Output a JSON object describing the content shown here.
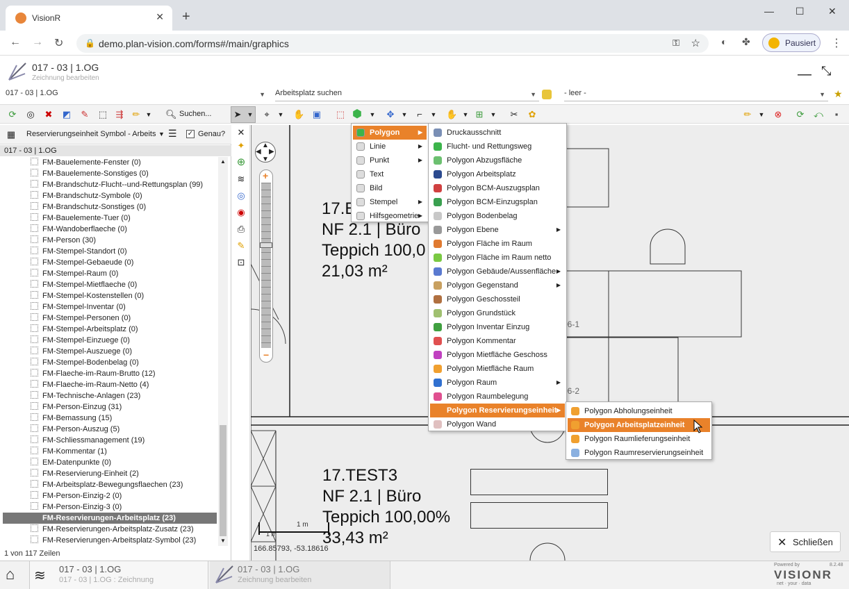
{
  "browser": {
    "tab_title": "VisionR",
    "new_tab": "+",
    "url": "demo.plan-vision.com/forms#/main/graphics",
    "paused_label": "Pausiert"
  },
  "header": {
    "title": "017 - 03 | 1.OG",
    "subtitle": "Zeichnung bearbeiten"
  },
  "selectors": {
    "drawing": "017 - 03 | 1.OG",
    "workplace_search": "Arbeitsplatz suchen",
    "empty": "- leer -"
  },
  "toolbar": {
    "search_label": "Suchen..."
  },
  "left_panel": {
    "layer_select": "Reservierungseinheit Symbol - Arbeits",
    "exact_label": "Genau?",
    "exact_checked": true,
    "group_header": "017 - 03 | 1.OG",
    "items": [
      "FM-Bauelemente-Fenster (0)",
      "FM-Bauelemente-Sonstiges (0)",
      "FM-Brandschutz-Flucht--und-Rettungsplan (99)",
      "FM-Brandschutz-Symbole (0)",
      "FM-Brandschutz-Sonstiges (0)",
      "FM-Bauelemente-Tuer (0)",
      "FM-Wandoberflaeche (0)",
      "FM-Person (30)",
      "FM-Stempel-Standort (0)",
      "FM-Stempel-Gebaeude (0)",
      "FM-Stempel-Raum (0)",
      "FM-Stempel-Mietflaeche (0)",
      "FM-Stempel-Kostenstellen (0)",
      "FM-Stempel-Inventar (0)",
      "FM-Stempel-Personen (0)",
      "FM-Stempel-Arbeitsplatz (0)",
      "FM-Stempel-Einzuege (0)",
      "FM-Stempel-Auszuege (0)",
      "FM-Stempel-Bodenbelag (0)",
      "FM-Flaeche-im-Raum-Brutto (12)",
      "FM-Flaeche-im-Raum-Netto (4)",
      "FM-Technische-Anlagen (23)",
      "FM-Person-Einzug (31)",
      "FM-Bemassung (15)",
      "FM-Person-Auszug (5)",
      "FM-Schliessmanagement (19)",
      "FM-Kommentar (1)",
      "EM-Datenpunkte (0)",
      "FM-Reservierung-Einheit (2)",
      "FM-Arbeitsplatz-Bewegungsflaechen (23)",
      "FM-Person-Einzig-2 (0)",
      "FM-Person-Einzig-3 (0)",
      "FM-Reservierungen-Arbeitsplatz (23)",
      "FM-Reservierungen-Arbeitsplatz-Zusatz (23)",
      "FM-Reservierungen-Arbeitsplatz-Symbol (23)"
    ],
    "selected_index": 32,
    "row_count": "1 von 117 Zeilen"
  },
  "canvas": {
    "room1_lines": [
      "17.E",
      "NF 2.1 | Büro",
      "Teppich 100,0",
      "21,03 m²"
    ],
    "room2_lines": [
      "17.TEST3",
      "NF 2.1 | Büro",
      "Teppich 100,00%",
      "33,43 m²"
    ],
    "label_a": "06-1",
    "label_b": "06-2",
    "scale_a": "1 m",
    "scale_b": "1 m",
    "coordinates": "166.85793, -53.18616",
    "zoom_plus": "+",
    "zoom_minus": "−"
  },
  "menu1": {
    "items": [
      "Polygon",
      "Linie",
      "Punkt",
      "Text",
      "Bild",
      "Stempel",
      "Hilfsgeometrie"
    ],
    "submenu": [
      true,
      true,
      true,
      false,
      false,
      true,
      true
    ],
    "icons": [
      "polygon-icon",
      "hexagon-outline-icon",
      "dot-icon",
      "text-icon",
      "image-icon",
      "stamp-icon",
      "helper-geometry-icon"
    ],
    "active_index": 0
  },
  "menu2": {
    "items": [
      "Druckausschnitt",
      "Flucht- und Rettungsweg",
      "Polygon Abzugsfläche",
      "Polygon Arbeitsplatz",
      "Polygon BCM-Auszugsplan",
      "Polygon BCM-Einzugsplan",
      "Polygon Bodenbelag",
      "Polygon Ebene",
      "Polygon Fläche im Raum",
      "Polygon Fläche im Raum netto",
      "Polygon Gebäude/Aussenfläche",
      "Polygon Gegenstand",
      "Polygon Geschossteil",
      "Polygon Grundstück",
      "Polygon Inventar Einzug",
      "Polygon Kommentar",
      "Polygon Mietfläche Geschoss",
      "Polygon Mietfläche Raum",
      "Polygon Raum",
      "Polygon Raumbelegung",
      "Polygon Reservierungseinheit",
      "Polygon Wand"
    ],
    "submenu": [
      false,
      false,
      false,
      false,
      false,
      false,
      false,
      true,
      false,
      false,
      true,
      true,
      false,
      false,
      false,
      false,
      false,
      false,
      true,
      false,
      true,
      false
    ],
    "colors": [
      "#7a8fb5",
      "#3cb44b",
      "#6cc070",
      "#2b4a8f",
      "#d04040",
      "#3aa050",
      "#c8c8c8",
      "#999999",
      "#e07a30",
      "#7ac943",
      "#5a7ad0",
      "#c8a060",
      "#b07040",
      "#a0c070",
      "#40a040",
      "#e05050",
      "#c040c0",
      "#f0a030",
      "#3070d0",
      "#e05090",
      "#e9822a",
      "#e0c0c0"
    ],
    "active_index": 20
  },
  "menu3": {
    "items": [
      "Polygon Abholungseinheit",
      "Polygon Arbeitsplatzeinheit",
      "Polygon Raumlieferungseinheit",
      "Polygon Raumreservierungseinheit"
    ],
    "colors": [
      "#f0a030",
      "#f0a030",
      "#f0a030",
      "#8ab0e0"
    ],
    "active_index": 1
  },
  "close_button": "Schließen",
  "bottom": {
    "crumb1_title": "017 - 03 | 1.OG",
    "crumb1_sub": "017 - 03 | 1.OG : Zeichnung",
    "crumb2_title": "017 - 03 | 1.OG",
    "crumb2_sub": "Zeichnung bearbeiten",
    "powered_by": "Powered by",
    "version": "8.2.48",
    "brand": "VISIONR",
    "tagline": "net · your · data"
  }
}
